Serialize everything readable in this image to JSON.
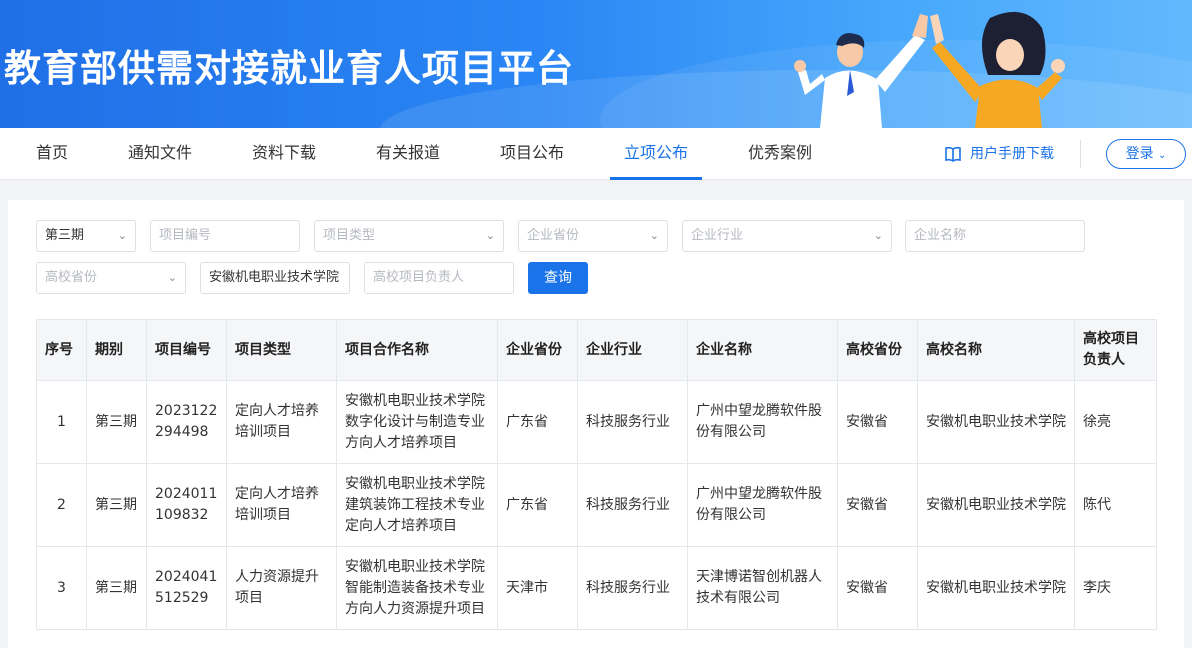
{
  "header": {
    "title": "教育部供需对接就业育人项目平台"
  },
  "nav": {
    "items": [
      {
        "label": "首页",
        "active": false
      },
      {
        "label": "通知文件",
        "active": false
      },
      {
        "label": "资料下载",
        "active": false
      },
      {
        "label": "有关报道",
        "active": false
      },
      {
        "label": "项目公布",
        "active": false
      },
      {
        "label": "立项公布",
        "active": true
      },
      {
        "label": "优秀案例",
        "active": false
      }
    ],
    "manual_label": "用户手册下载",
    "login_label": "登录"
  },
  "filters": {
    "period": "第三期",
    "project_no_placeholder": "项目编号",
    "project_type_placeholder": "项目类型",
    "company_province_placeholder": "企业省份",
    "company_industry_placeholder": "企业行业",
    "company_name_placeholder": "企业名称",
    "school_province_placeholder": "高校省份",
    "school_name_value": "安徽机电职业技术学院",
    "school_leader_placeholder": "高校项目负责人",
    "query_label": "查询"
  },
  "table": {
    "headers": [
      "序号",
      "期别",
      "项目编号",
      "项目类型",
      "项目合作名称",
      "企业省份",
      "企业行业",
      "企业名称",
      "高校省份",
      "高校名称",
      "高校项目负责人"
    ],
    "rows": [
      [
        "1",
        "第三期",
        "2023122294498",
        "定向人才培养培训项目",
        "安徽机电职业技术学院数字化设计与制造专业方向人才培养项目",
        "广东省",
        "科技服务行业",
        "广州中望龙腾软件股份有限公司",
        "安徽省",
        "安徽机电职业技术学院",
        "徐亮"
      ],
      [
        "2",
        "第三期",
        "2024011109832",
        "定向人才培养培训项目",
        "安徽机电职业技术学院建筑装饰工程技术专业定向人才培养项目",
        "广东省",
        "科技服务行业",
        "广州中望龙腾软件股份有限公司",
        "安徽省",
        "安徽机电职业技术学院",
        "陈代"
      ],
      [
        "3",
        "第三期",
        "2024041512529",
        "人力资源提升项目",
        "安徽机电职业技术学院智能制造装备技术专业方向人力资源提升项目",
        "天津市",
        "科技服务行业",
        "天津博诺智创机器人技术有限公司",
        "安徽省",
        "安徽机电职业技术学院",
        "李庆"
      ]
    ]
  }
}
